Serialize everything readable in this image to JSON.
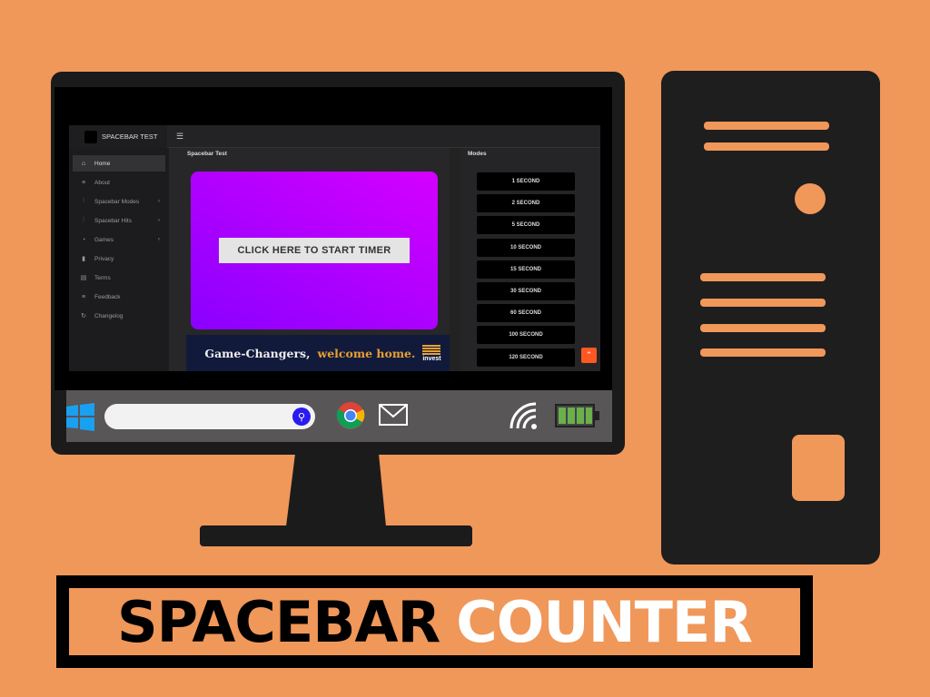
{
  "app": {
    "brand": "SPACEBAR TEST",
    "menu_icon": "hamburger-icon",
    "nav": [
      {
        "label": "Home",
        "icon": "home-icon",
        "active": true
      },
      {
        "label": "About",
        "icon": "list-icon"
      },
      {
        "label": "Spacebar Modes",
        "icon": "sliders-icon",
        "submenu": true
      },
      {
        "label": "Spacebar Hits",
        "icon": "sliders-icon",
        "submenu": true
      },
      {
        "label": "Games",
        "icon": "palette-icon",
        "submenu": true
      },
      {
        "label": "Privacy",
        "icon": "lock-icon"
      },
      {
        "label": "Terms",
        "icon": "file-icon"
      },
      {
        "label": "Feedback",
        "icon": "list-icon"
      },
      {
        "label": "Changelog",
        "icon": "refresh-icon"
      }
    ],
    "main_title": "Spacebar Test",
    "start_button": "CLICK HERE TO START TIMER",
    "ad": {
      "text_white": "Game-Changers,",
      "text_gold": "welcome home.",
      "logo": "invest"
    },
    "modes_title": "Modes",
    "modes": [
      "1 SECOND",
      "2 SECOND",
      "5 SECOND",
      "10 SECOND",
      "15 SECOND",
      "30 SECOND",
      "60 SECOND",
      "100 SECOND",
      "120 SECOND"
    ]
  },
  "banner": {
    "word1": "SPACEBAR",
    "word2": "COUNTER"
  },
  "colors": {
    "background": "#F0975A",
    "hero_from": "#8a00ff",
    "hero_to": "#d400ff",
    "scroll_top": "#ff5722"
  }
}
